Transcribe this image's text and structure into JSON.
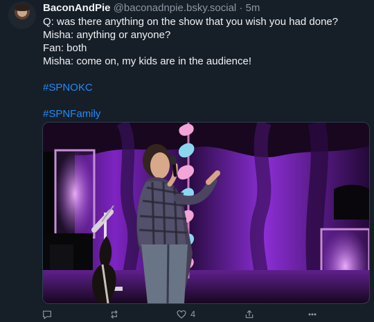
{
  "post": {
    "author": "BaconAndPie",
    "handle": "@baconadnpie.bsky.social",
    "separator": "·",
    "time": "5m",
    "lines": [
      "Q: was there anything on the show that you wish you had done?",
      "Misha: anything or anyone?",
      "Fan: both",
      "Misha: come on, my kids are in the audience!"
    ],
    "hashtags": [
      "#SPNOKC",
      "#SPNFamily"
    ]
  },
  "actions": {
    "reply_icon": "reply-icon",
    "repost_icon": "repost-icon",
    "like_icon": "heart-icon",
    "like_count": "4",
    "share_icon": "share-icon",
    "more_icon": "more-icon"
  },
  "colors": {
    "background": "#161e27",
    "text": "#f1f3f5",
    "muted": "#8d98a5",
    "link": "#208bfe",
    "stage_purple": "#8f2fd0"
  }
}
